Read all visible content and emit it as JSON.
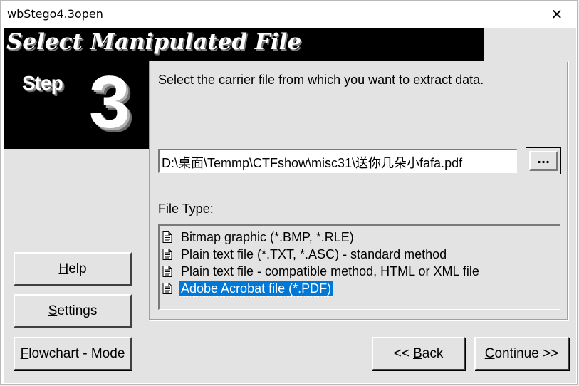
{
  "window": {
    "title": "wbStego4.3open",
    "close_glyph": "✕"
  },
  "banner": {
    "title": "Select Manipulated File"
  },
  "step": {
    "word": "Step",
    "number": "3"
  },
  "main": {
    "instruction": "Select the carrier file from which you want to extract data.",
    "path_value": "D:\\桌面\\Temmp\\CTFshow\\misc31\\送你几朵小fafa.pdf",
    "browse_label": "...",
    "file_type_label": "File Type:",
    "file_types": [
      {
        "label": "Bitmap graphic (*.BMP, *.RLE)",
        "icon": "document-icon",
        "selected": false
      },
      {
        "label": "Plain text file (*.TXT, *.ASC) - standard method",
        "icon": "document-icon",
        "selected": false
      },
      {
        "label": "Plain text file - compatible method, HTML or XML file",
        "icon": "document-icon",
        "selected": false
      },
      {
        "label": "Adobe Acrobat file (*.PDF)",
        "icon": "document-icon",
        "selected": true
      }
    ]
  },
  "buttons": {
    "help_first": "H",
    "help_rest": "elp",
    "settings_first": "S",
    "settings_rest": "ettings",
    "flow_first": "F",
    "flow_rest": "lowchart - Mode",
    "back_prefix": "<< ",
    "back_first": "B",
    "back_rest": "ack",
    "continue_first": "C",
    "continue_rest": "ontinue >>"
  },
  "colors": {
    "selection": "#0078d7",
    "banner": "#000000",
    "face": "#e3e3e3"
  }
}
